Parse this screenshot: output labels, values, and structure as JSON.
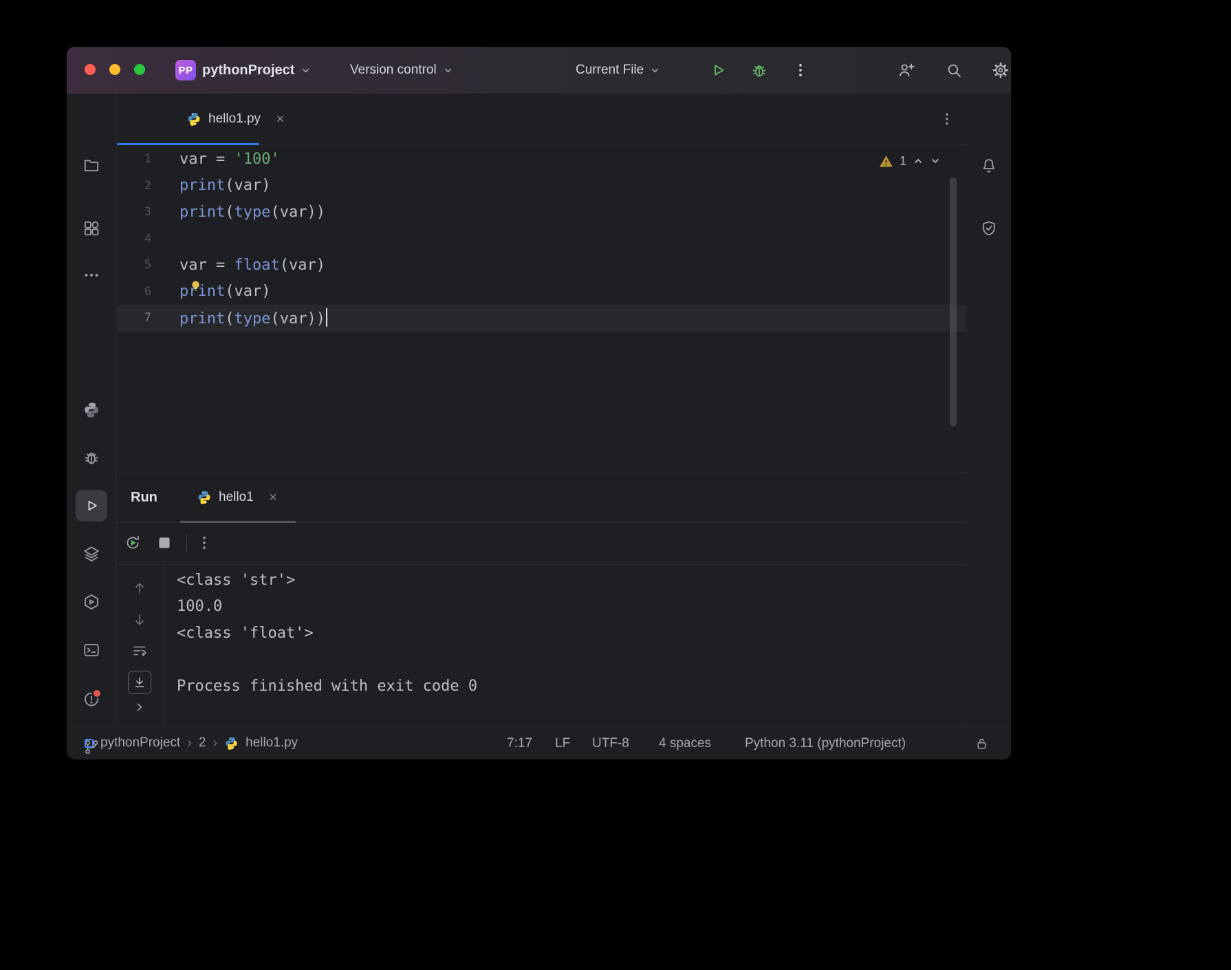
{
  "colors": {
    "accent_blue": "#3574f0",
    "string_green": "#6aab73",
    "builtin_blue": "#7a93d4",
    "warning_yellow": "#b9952f",
    "run_green": "#5fb865",
    "error_red": "#e3554d"
  },
  "title_bar": {
    "project_badge": "PP",
    "project_name": "pythonProject",
    "vcs_widget": "Version control",
    "run_widget": "Current File"
  },
  "editor": {
    "tab_label": "hello1.py",
    "inspection_warning_count": "1",
    "lines": [
      {
        "num": "1",
        "tokens": [
          [
            "plain",
            "var = "
          ],
          [
            "str",
            "'100'"
          ]
        ]
      },
      {
        "num": "2",
        "tokens": [
          [
            "fn",
            "print"
          ],
          [
            "plain",
            "(var)"
          ]
        ]
      },
      {
        "num": "3",
        "tokens": [
          [
            "fn",
            "print"
          ],
          [
            "plain",
            "("
          ],
          [
            "fn",
            "type"
          ],
          [
            "plain",
            "(var))"
          ]
        ]
      },
      {
        "num": "4",
        "tokens": []
      },
      {
        "num": "5",
        "tokens": [
          [
            "plain",
            "var = "
          ],
          [
            "fn",
            "float"
          ],
          [
            "plain",
            "(var)"
          ]
        ]
      },
      {
        "num": "6",
        "tokens": [
          [
            "fn",
            "print"
          ],
          [
            "plain",
            "(var)"
          ]
        ],
        "bulb": true
      },
      {
        "num": "7",
        "tokens": [
          [
            "fn",
            "print"
          ],
          [
            "plain",
            "("
          ],
          [
            "fn",
            "type"
          ],
          [
            "plain",
            "(var))"
          ]
        ],
        "current": true,
        "caret": true
      }
    ]
  },
  "run_panel": {
    "title": "Run",
    "tab_label": "hello1",
    "output": [
      "<class 'str'>",
      "100.0",
      "<class 'float'>",
      "",
      "Process finished with exit code 0"
    ]
  },
  "status_bar": {
    "breadcrumb": [
      "pythonProject",
      "2",
      "hello1.py"
    ],
    "caret_position": "7:17",
    "line_separator": "LF",
    "encoding": "UTF-8",
    "indent": "4 spaces",
    "interpreter": "Python 3.11 (pythonProject)"
  }
}
